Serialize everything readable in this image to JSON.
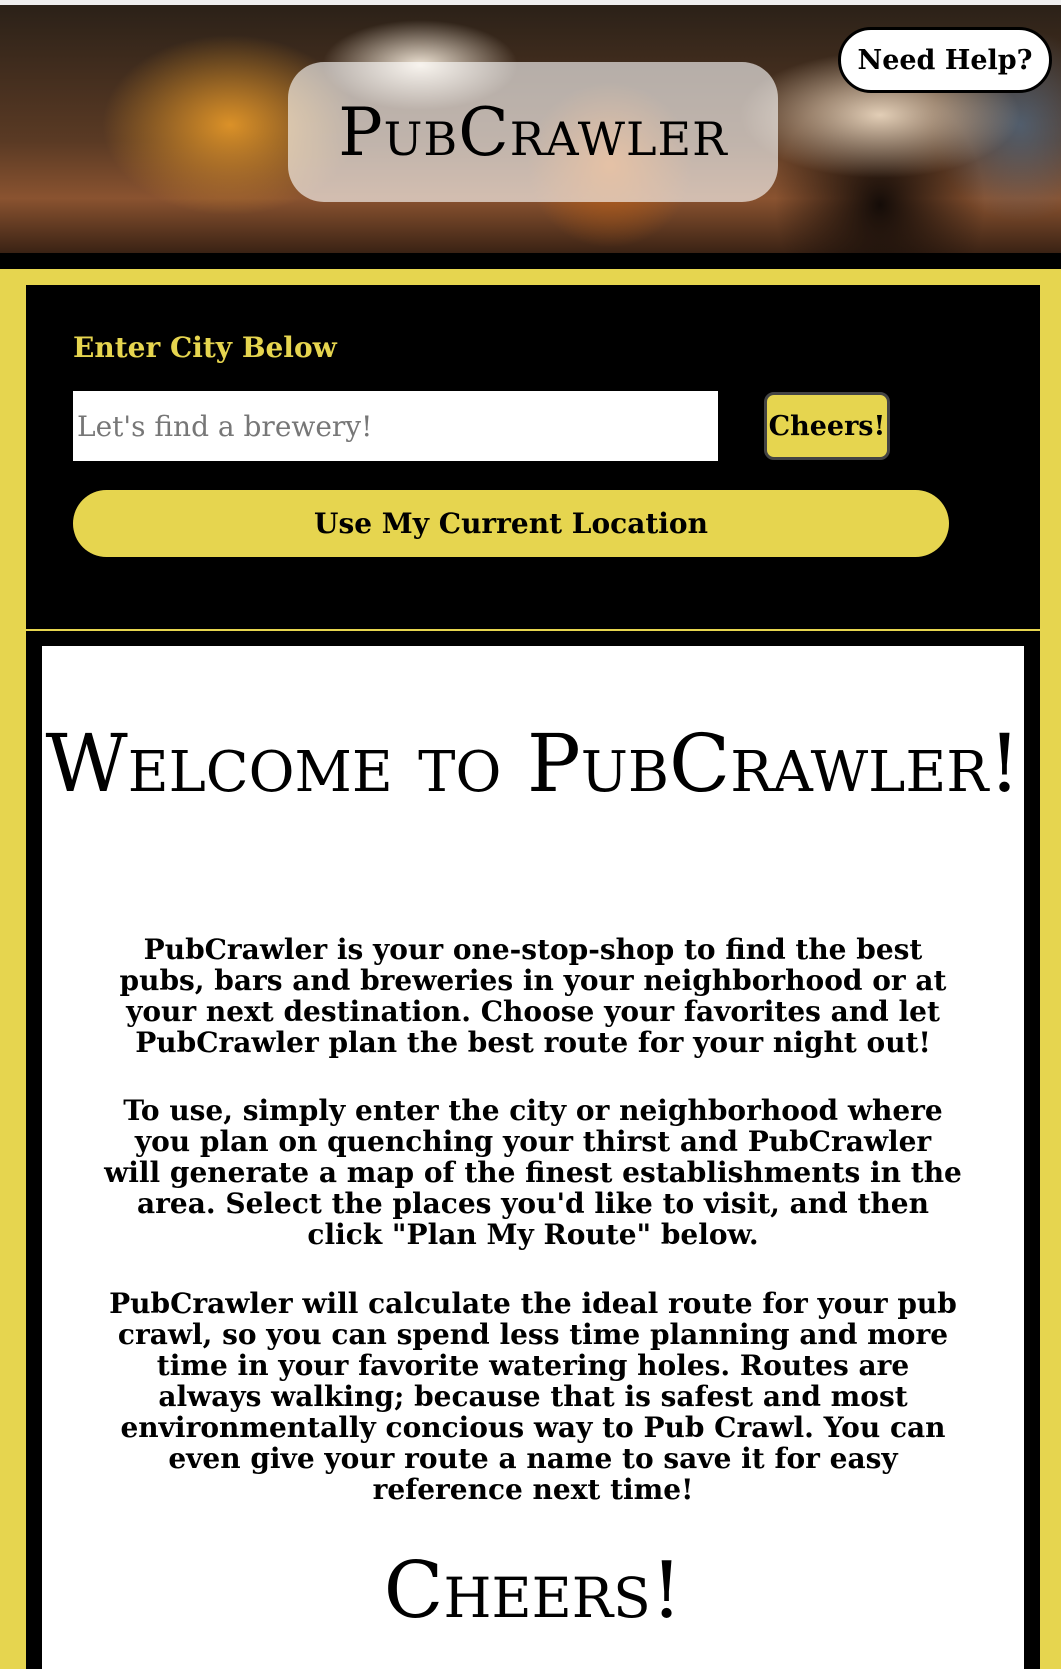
{
  "header": {
    "title": "PubCrawler",
    "help_label": "Need Help?"
  },
  "search": {
    "label": "Enter City Below",
    "placeholder": "Let's find a brewery!",
    "value": "",
    "submit_label": "Cheers!",
    "location_label": "Use My Current Location"
  },
  "welcome": {
    "heading": "Welcome to PubCrawler!",
    "paragraphs": [
      "PubCrawler is your one-stop-shop to find the best pubs, bars and breweries in your neighborhood or at your next destination. Choose your favorites and let PubCrawler plan the best route for your night out!",
      "To use, simply enter the city or neighborhood where you plan on quenching your thirst and PubCrawler will generate a map of the finest establishments in the area. Select the places you'd like to visit, and then click \"Plan My Route\" below.",
      "PubCrawler will calculate the ideal route for your pub crawl, so you can spend less time planning and more time in your favorite watering holes. Routes are always walking; because that is safest and most environmentally concious way to Pub Crawl. You can even give your route a name to save it for easy reference next time!"
    ],
    "closing": "Cheers!"
  },
  "colors": {
    "accent": "#e6d54f",
    "panel": "#000000",
    "card": "#ffffff"
  }
}
